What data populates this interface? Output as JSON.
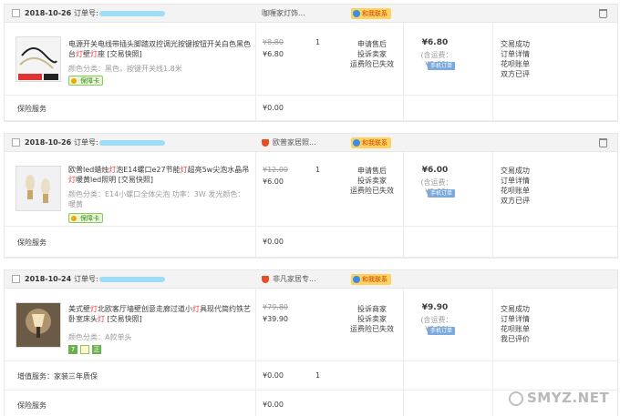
{
  "orders": [
    {
      "date": "2018-10-26",
      "order_label": "订单号:",
      "shop": "咖喱家灯饰...",
      "contact": "和我联系",
      "item": {
        "title_parts": [
          "电源开关电线带插头脚踏双控调光按键按钮开关白色黑色台",
          "灯",
          "壁",
          "灯",
          "座 [交易快照]"
        ],
        "sku": "颜色分类：黑色，按键开关线1.8米",
        "badge": "保障卡",
        "orig_price": "¥8.80",
        "price": "¥6.80",
        "qty": "1",
        "status": [
          "申请售后",
          "投诉卖家",
          "运费险已失效"
        ],
        "total": "¥6.80",
        "ship": "(含运费：¥0.00)",
        "mobile": "手机订单",
        "ops": [
          "交易成功",
          "订单详情",
          "花呗账单",
          "双方已评"
        ]
      },
      "service_label": "保险服务",
      "service_price": "¥0.00"
    },
    {
      "date": "2018-10-26",
      "order_label": "订单号:",
      "shop": "欧普家居照...",
      "contact": "和我联系",
      "item": {
        "title_parts": [
          "欧普led蜡烛",
          "灯",
          "泡E14螺口e27节能",
          "灯",
          "超亮5w尖泡水晶吊",
          "灯",
          "暖黄led照明 [交易快照]"
        ],
        "sku": "颜色分类：E14小螺口全体尖泡  功率：3W  发光颜色：暖黄",
        "badge": "保障卡",
        "orig_price": "¥12.00",
        "price": "¥6.00",
        "qty": "1",
        "status": [
          "申请售后",
          "投诉卖家",
          "运费险已失效"
        ],
        "total": "¥6.00",
        "ship": "(含运费：¥0.00)",
        "mobile": "手机订单",
        "ops": [
          "交易成功",
          "订单详情",
          "花呗账单",
          "双方已评"
        ]
      },
      "service_label": "保险服务",
      "service_price": "¥0.00"
    },
    {
      "date": "2018-10-24",
      "order_label": "订单号:",
      "shop": "非凡家居专...",
      "contact": "和我联系",
      "item": {
        "title_parts": [
          "美式壁",
          "灯",
          "北欧客厅墙壁创意走廊过道小",
          "灯",
          "具现代简约铁艺卧室床头",
          "灯",
          " [交易快照]"
        ],
        "sku": "颜色分类：A款单头",
        "orig_price": "¥79.80",
        "price": "¥39.90",
        "qty": "1",
        "status": [
          "投诉商家",
          "投诉卖家",
          "运费险已失效"
        ],
        "total": "¥9.90",
        "ship": "(含运费：¥0.00)",
        "mobile": "手机订单",
        "ops": [
          "交易成功",
          "订单详情",
          "花呗账单",
          "我已评价"
        ]
      },
      "extra_label": "增值服务：家装三年质保",
      "extra_price": "¥0.00",
      "extra_qty": "1",
      "service_label": "保险服务",
      "service_price": "¥0.00"
    }
  ],
  "watermark": "SMYZ.NET",
  "colors": {
    "highlight": "#e4393c",
    "chat": "#ffd25f",
    "mobile_btn": "#7aa9dd"
  }
}
